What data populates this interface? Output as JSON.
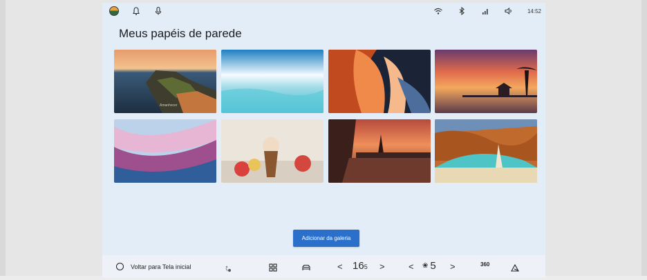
{
  "statusbar": {
    "time": "14:52",
    "left_icons": [
      "app-avatar-icon",
      "bell-icon",
      "mic-icon"
    ],
    "right_icons": [
      "wifi-icon",
      "bluetooth-icon",
      "signal-icon",
      "volume-icon"
    ]
  },
  "page": {
    "title": "Meus papéis de parede"
  },
  "gallery": {
    "wallpapers": [
      {
        "name": "coastal-cliff-sunset",
        "caption": "Amanhecer"
      },
      {
        "name": "frozen-sea"
      },
      {
        "name": "abstract-orange-petals"
      },
      {
        "name": "tropical-pier-sunset"
      },
      {
        "name": "pastel-silk-waves"
      },
      {
        "name": "kitten-in-cup"
      },
      {
        "name": "pagoda-terrace-sunset"
      },
      {
        "name": "sea-cave-beach"
      }
    ]
  },
  "actions": {
    "add_label": "Adicionar da galeria"
  },
  "bottombar": {
    "home_label": "Voltar para Tela inicial",
    "temperature": "16",
    "temperature_unit": "5",
    "fan_level": "5",
    "view_360": "360",
    "prev": "<",
    "next": ">"
  },
  "colors": {
    "screen_bg": "#e3edf8",
    "accent": "#2a6fc9"
  }
}
